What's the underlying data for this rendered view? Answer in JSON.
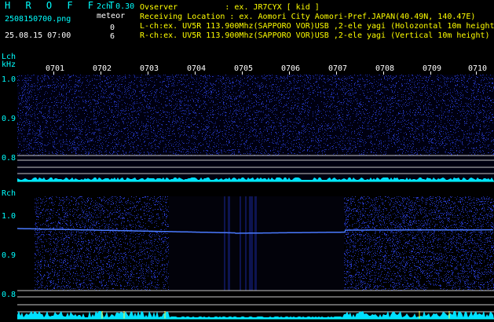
{
  "header": {
    "app_title": "H R O F F T",
    "version": "2ch 0.30",
    "filename": "2508150700.png",
    "meteor_label": "meteor",
    "lch_count": "0",
    "rch_count": "6",
    "datetime": "25.08.15 07:00"
  },
  "info": {
    "observer": "Ovserver          : ex. JR7CYX [ kid ]",
    "location": "Receiving Location : ex. Aomori City Aomori-Pref.JAPAN(40.49N, 140.47E)",
    "lch": "L-ch:ex. UV5R 113.900Mhz(SAPPORO VOR)USB ,2-ele yagi (Holozontal 10m height",
    "rch": "R-ch:ex. UV5R 113.900Mhz(SAPPORO VOR)USB ,2-ele yagi (Vertical 10m height)"
  },
  "time_ticks": [
    "0701",
    "0702",
    "0703",
    "0704",
    "0705",
    "0706",
    "0707",
    "0708",
    "0709",
    "0710"
  ],
  "lch_panel": {
    "channel_label": "Lch",
    "unit_label": "kHz",
    "y_labels": [
      "1.0",
      "0.9",
      "0.8"
    ]
  },
  "rch_panel": {
    "channel_label": "Rch",
    "y_labels": [
      "1.0",
      "0.9",
      "0.8"
    ]
  },
  "colors": {
    "background": "#000000",
    "text_cyan": "#00ffff",
    "text_yellow": "#ffff00",
    "noise": "#1a2a9a",
    "signal": "#4a7aff"
  }
}
